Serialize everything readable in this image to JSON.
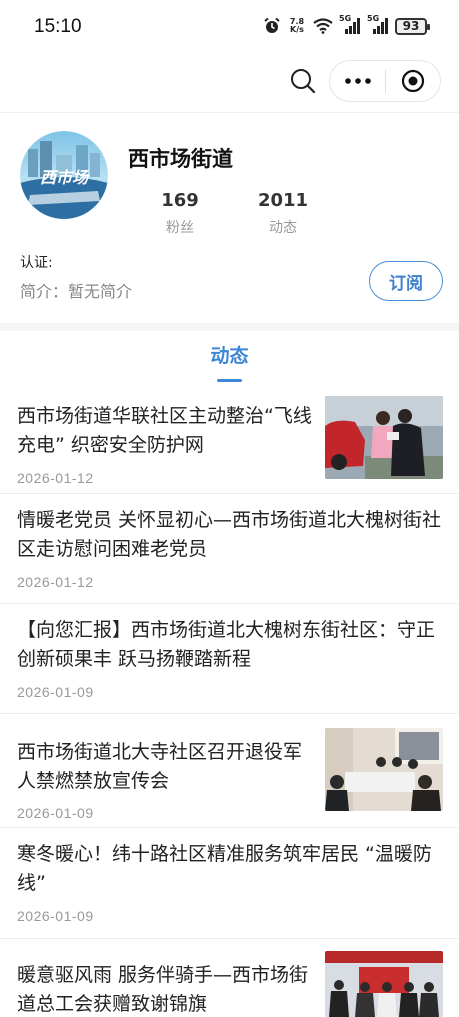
{
  "status_bar": {
    "time": "15:10",
    "net_speed_value": "7.8",
    "net_speed_unit": "K/s",
    "signal1": "5G",
    "signal2": "5G",
    "battery": "93"
  },
  "toolbar": {
    "search_icon": "search-icon",
    "more_icon": "more-icon",
    "target_icon": "target-icon"
  },
  "profile": {
    "name": "西市场街道",
    "avatar_text": "西市场",
    "stats": [
      {
        "value": "169",
        "label": "粉丝"
      },
      {
        "value": "2011",
        "label": "动态"
      }
    ],
    "verify_label": "认证:",
    "intro": "简介：暂无简介",
    "subscribe_label": "订阅",
    "accent_color": "#3c87d6"
  },
  "tabs": [
    {
      "label": "动态"
    }
  ],
  "articles": [
    {
      "title": "西市场街道华联社区主动整治“飞线充电” 织密安全防护网",
      "date": "2026-01-12",
      "has_thumb": true
    },
    {
      "title": "情暖老党员  关怀显初心—西市场街道北大槐树街社区走访慰问困难老党员",
      "date": "2026-01-12",
      "has_thumb": false
    },
    {
      "title": "【向您汇报】西市场街道北大槐树东街社区：守正创新硕果丰     跃马扬鞭踏新程",
      "date": "2026-01-09",
      "has_thumb": false
    },
    {
      "title": "西市场街道北大寺社区召开退役军人禁燃禁放宣传会",
      "date": "2026-01-09",
      "has_thumb": true
    },
    {
      "title": "寒冬暖心！纬十路社区精准服务筑牢居民 “温暖防线”",
      "date": "2026-01-09",
      "has_thumb": false
    },
    {
      "title": "暖意驱风雨  服务伴骑手—西市场街道总工会获赠致谢锦旗",
      "date": "",
      "has_thumb": true
    }
  ]
}
